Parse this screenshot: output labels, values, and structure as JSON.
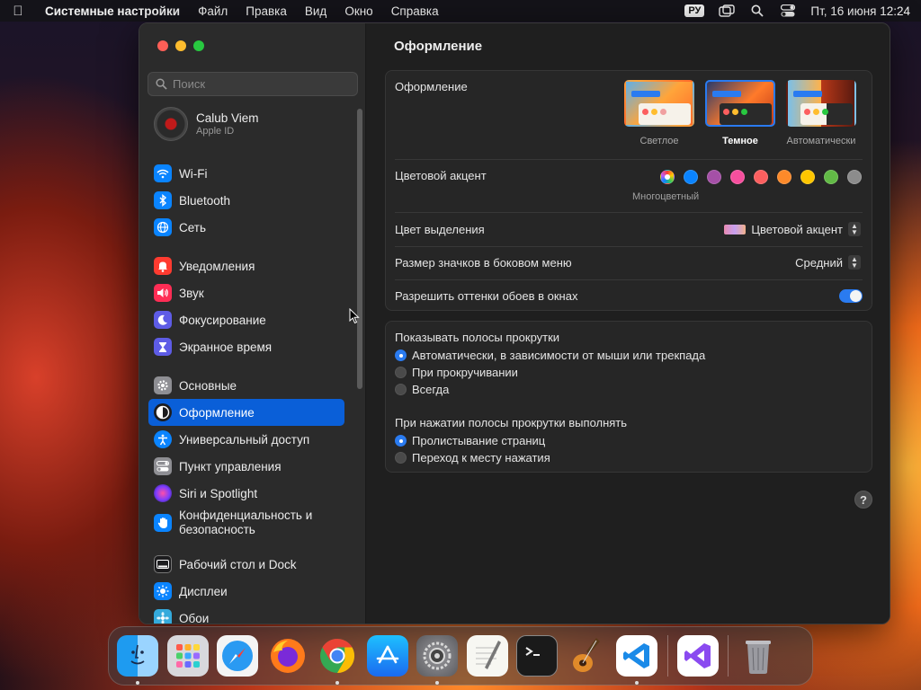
{
  "menubar": {
    "app_name": "Системные настройки",
    "items": [
      "Файл",
      "Правка",
      "Вид",
      "Окно",
      "Справка"
    ],
    "input_source": "РУ",
    "clock": "Пт, 16 июня  12:24"
  },
  "sidebar": {
    "search_placeholder": "Поиск",
    "profile": {
      "name": "Calub Viem",
      "subtitle": "Apple ID"
    },
    "items": [
      {
        "label": "Wi-Fi",
        "icon": "wifi-icon",
        "color": "#0a84ff"
      },
      {
        "label": "Bluetooth",
        "icon": "bluetooth-icon",
        "color": "#0a84ff"
      },
      {
        "label": "Сеть",
        "icon": "globe-icon",
        "color": "#0a84ff"
      },
      {
        "label": "Уведомления",
        "icon": "bell-icon",
        "color": "#ff3b30"
      },
      {
        "label": "Звук",
        "icon": "speaker-icon",
        "color": "#ff2d55"
      },
      {
        "label": "Фокусирование",
        "icon": "moon-icon",
        "color": "#5e5ce6"
      },
      {
        "label": "Экранное время",
        "icon": "hourglass-icon",
        "color": "#5e5ce6"
      },
      {
        "label": "Основные",
        "icon": "gear-icon",
        "color": "#8e8e93"
      },
      {
        "label": "Оформление",
        "icon": "appearance-icon",
        "color": "#1c1c1e"
      },
      {
        "label": "Универсальный доступ",
        "icon": "accessibility-icon",
        "color": "#0a84ff"
      },
      {
        "label": "Пункт управления",
        "icon": "control-center-icon",
        "color": "#8e8e93"
      },
      {
        "label": "Siri и Spotlight",
        "icon": "siri-icon",
        "color": "#bf5af2"
      },
      {
        "label": "Конфиденциальность и безопасность",
        "icon": "hand-icon",
        "color": "#0a84ff"
      },
      {
        "label": "Рабочий стол и Dock",
        "icon": "dock-icon",
        "color": "#1c1c1e"
      },
      {
        "label": "Дисплеи",
        "icon": "sun-icon",
        "color": "#0a84ff"
      },
      {
        "label": "Обои",
        "icon": "wallpaper-icon",
        "color": "#34aadc"
      }
    ]
  },
  "main": {
    "title": "Оформление",
    "appearance": {
      "label": "Оформление",
      "options": [
        "Светлое",
        "Темное",
        "Автоматически"
      ],
      "selected": "Темное"
    },
    "accent": {
      "label": "Цветовой акцент",
      "colors": [
        "multicolor",
        "#0a84ff",
        "#a550a7",
        "#f74f9e",
        "#fc5f5f",
        "#fd8a2a",
        "#ffc600",
        "#62ba46",
        "#8c8c8c"
      ],
      "selected_caption": "Многоцветный"
    },
    "highlight": {
      "label": "Цвет выделения",
      "value": "Цветовой акцент"
    },
    "sidebar_icon_size": {
      "label": "Размер значков в боковом меню",
      "value": "Средний"
    },
    "wallpaper_tinting": {
      "label": "Разрешить оттенки обоев в окнах",
      "enabled": true
    },
    "scrollbars": {
      "label": "Показывать полосы прокрутки",
      "options": [
        "Автоматически, в зависимости от мыши или трекпада",
        "При прокручивании",
        "Всегда"
      ],
      "selected": 0
    },
    "scroll_click": {
      "label": "При нажатии полосы прокрутки выполнять",
      "options": [
        "Пролистывание страниц",
        "Переход к месту нажатия"
      ],
      "selected": 0
    },
    "help": "?"
  },
  "dock": {
    "apps": [
      "Finder",
      "Launchpad",
      "Safari",
      "Firefox",
      "Chrome",
      "App Store",
      "Системные настройки",
      "TextEdit",
      "Терминал",
      "GarageBand",
      "Visual Studio Code",
      "Visual Studio",
      "Корзина"
    ]
  }
}
